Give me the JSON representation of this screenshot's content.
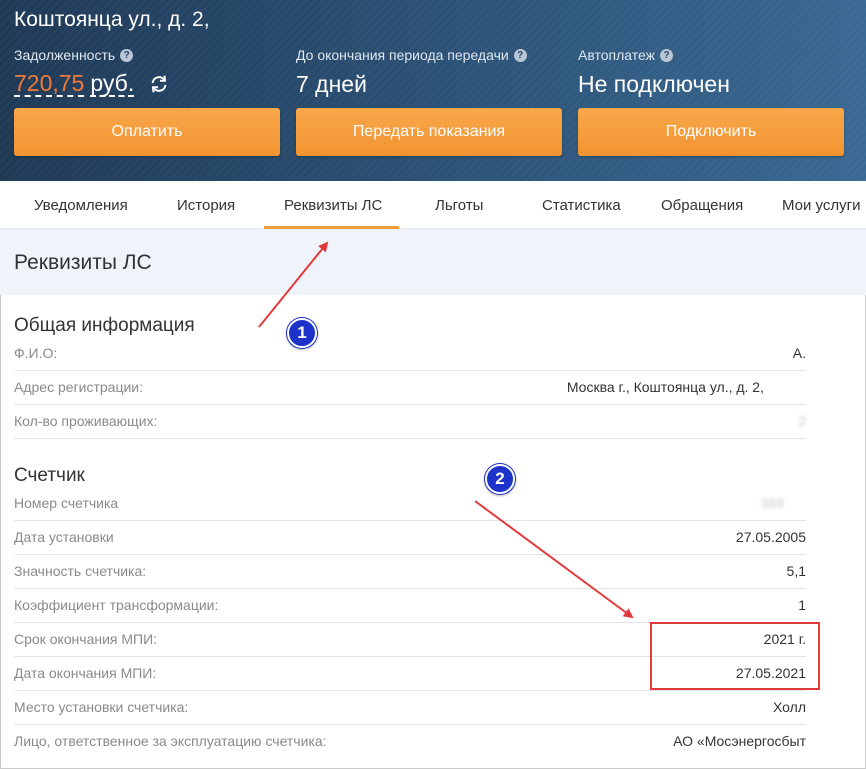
{
  "header": {
    "address": "Коштоянца ул., д. 2,",
    "debt": {
      "label": "Задолженность",
      "amount": "720,75",
      "unit": "руб."
    },
    "period": {
      "label": "До окончания периода передачи",
      "value": "7 дней"
    },
    "autopay": {
      "label": "Автоплатеж",
      "value": "Не подключен"
    },
    "buttons": {
      "pay": "Оплатить",
      "submit_readings": "Передать показания",
      "connect": "Подключить"
    }
  },
  "tabs": [
    "Уведомления",
    "История",
    "Реквизиты ЛС",
    "Льготы",
    "Статистика",
    "Обращения",
    "Мои услуги"
  ],
  "active_tab": "Реквизиты ЛС",
  "page_title": "Реквизиты ЛС",
  "general": {
    "title": "Общая информация",
    "rows": [
      {
        "label": "Ф.И.О:",
        "value": "А."
      },
      {
        "label": "Адрес регистрации:",
        "value": "Москва г., Коштоянца ул., д. 2,"
      },
      {
        "label": "Кол-во проживающих:",
        "value": "2"
      }
    ]
  },
  "meter": {
    "title": "Счетчик",
    "rows": [
      {
        "label": "Номер счетчика",
        "value": "389"
      },
      {
        "label": "Дата установки",
        "value": "27.05.2005"
      },
      {
        "label": "Значность счетчика:",
        "value": "5,1"
      },
      {
        "label": "Коэффициент трансформации:",
        "value": "1"
      },
      {
        "label": "Срок окончания МПИ:",
        "value": "2021 г."
      },
      {
        "label": "Дата окончания МПИ:",
        "value": "27.05.2021"
      },
      {
        "label": "Место установки счетчика:",
        "value": "Холл"
      },
      {
        "label": "Лицо, ответственное за эксплуатацию счетчика:",
        "value": "АО «Мосэнергосбыт"
      }
    ]
  },
  "annotations": {
    "badge1": "1",
    "badge2": "2"
  },
  "colors": {
    "header_dark": "#203a56",
    "accent_orange": "#f39332",
    "debt_red": "#f07a3a",
    "annotation_red": "#e23a3a",
    "badge_blue": "#1d32c9"
  }
}
